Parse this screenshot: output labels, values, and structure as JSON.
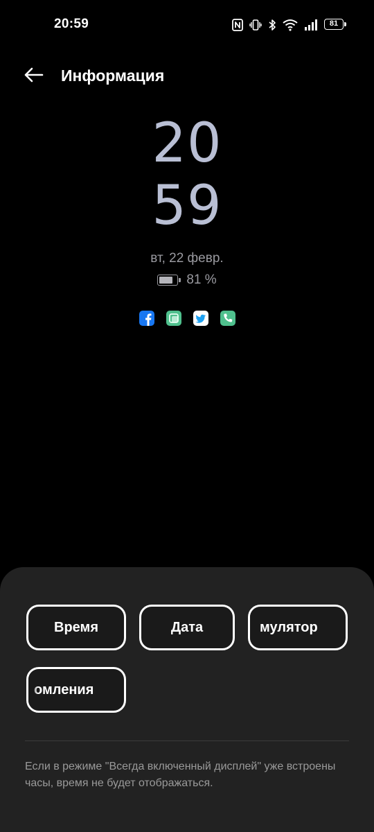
{
  "status_bar": {
    "time": "20:59",
    "battery_level": "81",
    "icons": [
      "nfc-icon",
      "vibrate-icon",
      "bluetooth-icon",
      "wifi-icon",
      "signal-icon",
      "battery-icon"
    ]
  },
  "header": {
    "title": "Информация",
    "back_icon": "arrow-left-icon"
  },
  "preview": {
    "hours": "20",
    "minutes": "59",
    "date": "вт, 22 февр.",
    "battery_text": "81 %",
    "battery_fraction": 0.81,
    "clock_color": "#b9bfd4",
    "app_icons": [
      {
        "name": "facebook-icon",
        "color": "#1877f2"
      },
      {
        "name": "messages-icon",
        "color": "#4fc08d"
      },
      {
        "name": "twitter-icon",
        "color": "#ffffff"
      },
      {
        "name": "phone-icon",
        "color": "#4fc08d"
      }
    ]
  },
  "bottom_sheet": {
    "options": [
      {
        "id": "time",
        "label": "Время"
      },
      {
        "id": "date",
        "label": "Дата"
      },
      {
        "id": "emulator",
        "label": "мулятор"
      },
      {
        "id": "notifications",
        "label": "омления"
      }
    ],
    "footnote": "Если в режиме \"Всегда включенный дисплей\" уже встроены часы, время не будет отображаться."
  }
}
